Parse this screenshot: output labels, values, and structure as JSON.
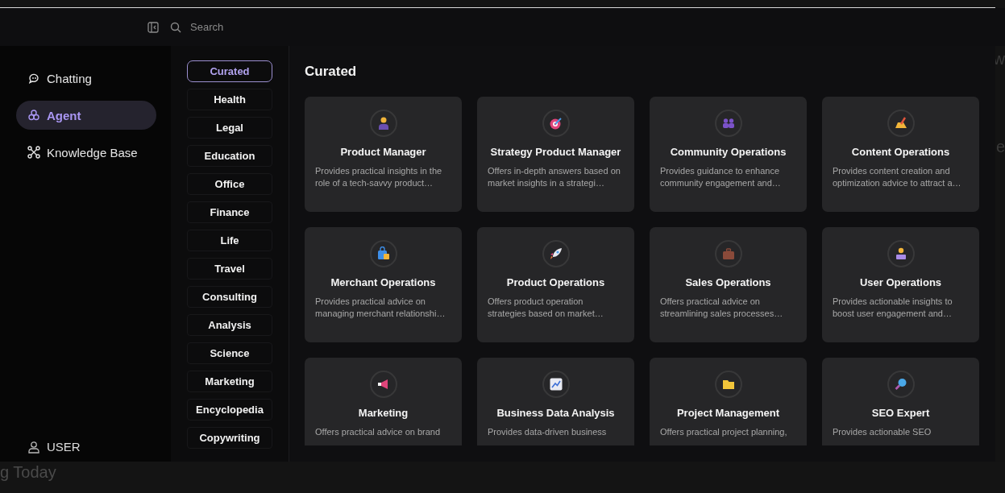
{
  "topbar": {
    "search": {
      "placeholder": "Search"
    }
  },
  "nav": [
    {
      "label": "Chatting",
      "selected": false
    },
    {
      "label": "Agent",
      "selected": true
    },
    {
      "label": "Knowledge Base",
      "selected": false
    }
  ],
  "user": {
    "label": "USER"
  },
  "categories": [
    {
      "label": "Curated",
      "selected": true
    },
    {
      "label": "Health",
      "selected": false
    },
    {
      "label": "Legal",
      "selected": false
    },
    {
      "label": "Education",
      "selected": false
    },
    {
      "label": "Office",
      "selected": false
    },
    {
      "label": "Finance",
      "selected": false
    },
    {
      "label": "Life",
      "selected": false
    },
    {
      "label": "Travel",
      "selected": false
    },
    {
      "label": "Consulting",
      "selected": false
    },
    {
      "label": "Analysis",
      "selected": false
    },
    {
      "label": "Science",
      "selected": false
    },
    {
      "label": "Marketing",
      "selected": false
    },
    {
      "label": "Encyclopedia",
      "selected": false
    },
    {
      "label": "Copywriting",
      "selected": false
    }
  ],
  "section_title": "Curated",
  "agents": [
    {
      "title": "Product Manager",
      "description": "Provides practical insights in the role of a tech-savvy product…"
    },
    {
      "title": "Strategy Product Manager",
      "description": "Offers in-depth answers based on market insights in a strategi…"
    },
    {
      "title": "Community Operations",
      "description": "Provides guidance to enhance community engagement and…"
    },
    {
      "title": "Content Operations",
      "description": "Provides content creation and optimization advice to attract a…"
    },
    {
      "title": "Merchant Operations",
      "description": "Provides practical advice on managing merchant relationshi…"
    },
    {
      "title": "Product Operations",
      "description": "Offers product operation strategies based on market…"
    },
    {
      "title": "Sales Operations",
      "description": "Offers practical advice on streamlining sales processes…"
    },
    {
      "title": "User Operations",
      "description": "Provides actionable insights to boost user engagement and…"
    },
    {
      "title": "Marketing",
      "description": "Offers practical advice on brand"
    },
    {
      "title": "Business Data Analysis",
      "description": "Provides data-driven business"
    },
    {
      "title": "Project Management",
      "description": "Offers practical project planning,"
    },
    {
      "title": "SEO Expert",
      "description": "Provides actionable SEO"
    }
  ],
  "background_fragments": [
    "w",
    "e",
    "g Today"
  ]
}
